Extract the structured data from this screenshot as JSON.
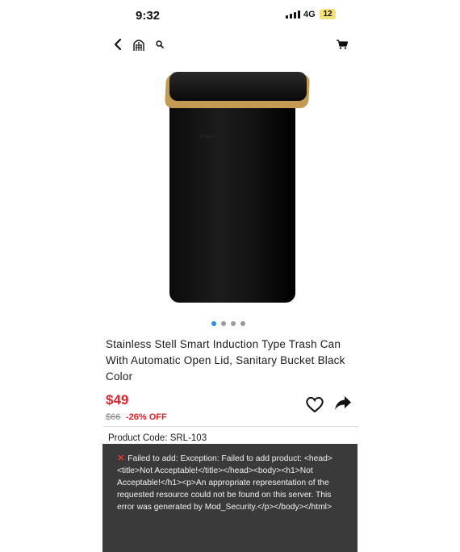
{
  "status_bar": {
    "time": "9:32",
    "network": "4G",
    "battery": "12"
  },
  "nav": {
    "icons": [
      "back-chevron-icon",
      "brand-logo-icon",
      "search-icon",
      "cart-icon"
    ]
  },
  "product": {
    "image_logo_text": "KAUX",
    "carousel": {
      "count": 4,
      "active_index": 0
    },
    "title": "Stainless Stell Smart Induction Type Trash Can With Automatic Open Lid, Sanitary Bucket Black Color",
    "price": "$49",
    "old_price": "$66",
    "discount": "-26% OFF",
    "product_code": "Product Code: SRL-103"
  },
  "toast": {
    "message": "Failed to add: Exception: Failed to add product: <head><title>Not Acceptable!</title></head><body><h1>Not Acceptable!</h1><p>An appropriate representation of the requested resource could not be found on this server. This error was generated by Mod_Security.</p></body></html>"
  },
  "colors": {
    "accent_red": "#d8252d",
    "dot_active": "#2c8cf0",
    "toast_bg": "#3a3a3a",
    "rim_gold": "#c49a52"
  }
}
